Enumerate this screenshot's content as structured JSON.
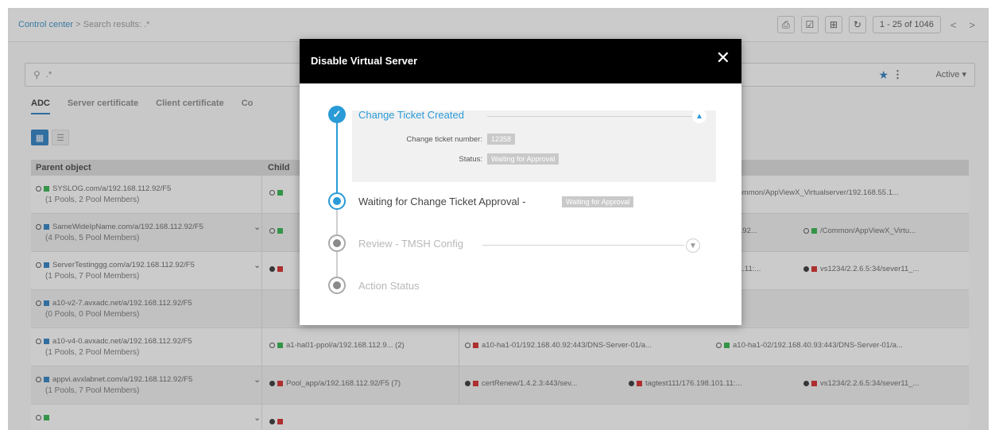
{
  "breadcrumb": {
    "root": "Control center",
    "separator": " > ",
    "current": "Search results: .*"
  },
  "pager": {
    "range": "1 - 25 of 1046",
    "prev": "<",
    "next": ">"
  },
  "search": {
    "value": ".*",
    "status_filter": "Active"
  },
  "tabs": [
    "ADC",
    "Server certificate",
    "Client certificate",
    "Co"
  ],
  "table": {
    "headers": [
      "Parent object",
      "Child"
    ],
    "rows": [
      {
        "parent": "SYSLOG.com/a/192.168.112.92/F5",
        "summary": "(1 Pools, 2 Pool Members)",
        "cells": [
          "/Common/AppViewX_Virtualserver/192.168.55.1..."
        ]
      },
      {
        "parent": "SameWideIpName.com/a/192.168.112.92/F5",
        "summary": "(4 Pools, 5 Pool Members)",
        "cells": [
          "192...",
          "/Common/AppViewX_Virtu..."
        ]
      },
      {
        "parent": "ServerTestinggg.com/a/192.168.112.92/F5",
        "summary": "(1 Pools, 7 Pool Members)",
        "cells": [
          "1.11:...",
          "vs1234/2.2.6.5:34/sever11_..."
        ]
      },
      {
        "parent": "a10-v2-7.avxadc.net/a/192.168.112.92/F5",
        "summary": "(0 Pools, 0 Pool Members)",
        "cells": []
      },
      {
        "parent": "a10-v4-0.avxadc.net/a/192.168.112.92/F5",
        "summary": "(1 Pools, 2 Pool Members)",
        "cells": [
          "a1-ha01-ppol/a/192.168.112.9... (2)",
          "a10-ha1-01/192.168.40.92:443/DNS-Server-01/a...",
          "a10-ha1-02/192.168.40.93:443/DNS-Server-01/a..."
        ]
      },
      {
        "parent": "appvi.avxlabnet.com/a/192.168.112.92/F5",
        "summary": "(1 Pools, 7 Pool Members)",
        "cells": [
          "Pool_app/a/192.168.112.92/F5 (7)",
          "certRenew/1.4.2.3:443/sev...",
          "tagtest111/176.198.101.11:...",
          "vs1234/2.2.6.5:34/sever11_..."
        ]
      }
    ]
  },
  "modal": {
    "title": "Disable Virtual Server",
    "steps": [
      {
        "title": "Change Ticket Created",
        "state": "done"
      },
      {
        "title": "Waiting for Change Ticket Approval - ",
        "badge": "Waiting for Approval",
        "state": "current"
      },
      {
        "title": "Review - TMSH Config",
        "state": "pending"
      },
      {
        "title": "Action Status",
        "state": "pending"
      }
    ],
    "ticket_label": "Change ticket number:",
    "ticket_value": "12358",
    "status_label": "Status:",
    "status_value": "Waiting for Approval"
  },
  "colors": {
    "accent": "#2a9bd7",
    "primary": "#2a7ec4",
    "ok": "#2fb34a",
    "error": "#d62728"
  }
}
